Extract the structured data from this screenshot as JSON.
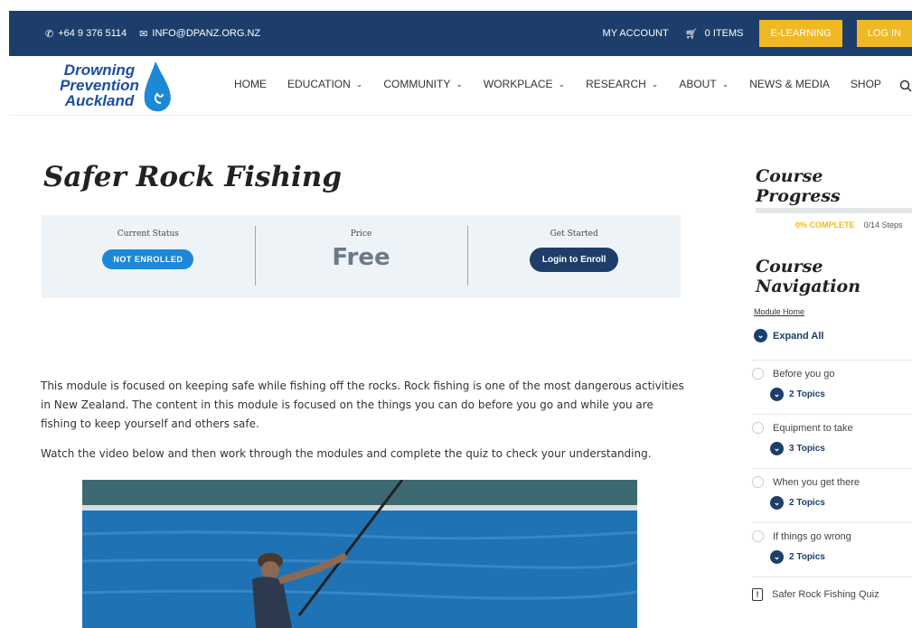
{
  "topbar": {
    "phone": "+64 9 376 5114",
    "email": "INFO@DPANZ.ORG.NZ",
    "my_account": "MY ACCOUNT",
    "cart": "0 ITEMS",
    "elearning": "E-LEARNING",
    "login": "LOG IN"
  },
  "logo": {
    "line1": "Drowning",
    "line2": "Prevention",
    "line3": "Auckland"
  },
  "nav": {
    "home": "HOME",
    "education": "EDUCATION",
    "community": "COMMUNITY",
    "workplace": "WORKPLACE",
    "research": "RESEARCH",
    "about": "ABOUT",
    "news": "NEWS & MEDIA",
    "shop": "SHOP"
  },
  "course": {
    "title": "Safer Rock Fishing",
    "status_label": "Current Status",
    "status_value": "NOT ENROLLED",
    "price_label": "Price",
    "price_value": "Free",
    "get_started_label": "Get Started",
    "enroll_button": "Login to Enroll",
    "paragraph1": "This module is focused on keeping safe while fishing off the rocks. Rock fishing is one of the most dangerous activities in New Zealand. The content in this module is focused on the things you can do before you go and while you are fishing to keep yourself and others safe.",
    "paragraph2": "Watch the video below and then work through the modules and complete the quiz to check your understanding."
  },
  "sidebar": {
    "progress_heading": "Course Progress",
    "progress_percent": "0% COMPLETE",
    "progress_steps": "0/14 Steps",
    "progress_fraction": 0,
    "nav_heading": "Course Navigation",
    "module_home": "Module Home",
    "expand_all": "Expand All",
    "lessons": [
      {
        "title": "Before you go",
        "topics": "2 Topics"
      },
      {
        "title": "Equipment to take",
        "topics": "3 Topics"
      },
      {
        "title": "When you get there",
        "topics": "2 Topics"
      },
      {
        "title": "If things go wrong",
        "topics": "2 Topics"
      }
    ],
    "quiz": "Safer Rock Fishing Quiz"
  },
  "colors": {
    "navy": "#1d3e6a",
    "yellow": "#f0b823",
    "blue_pill": "#1e88d8"
  }
}
